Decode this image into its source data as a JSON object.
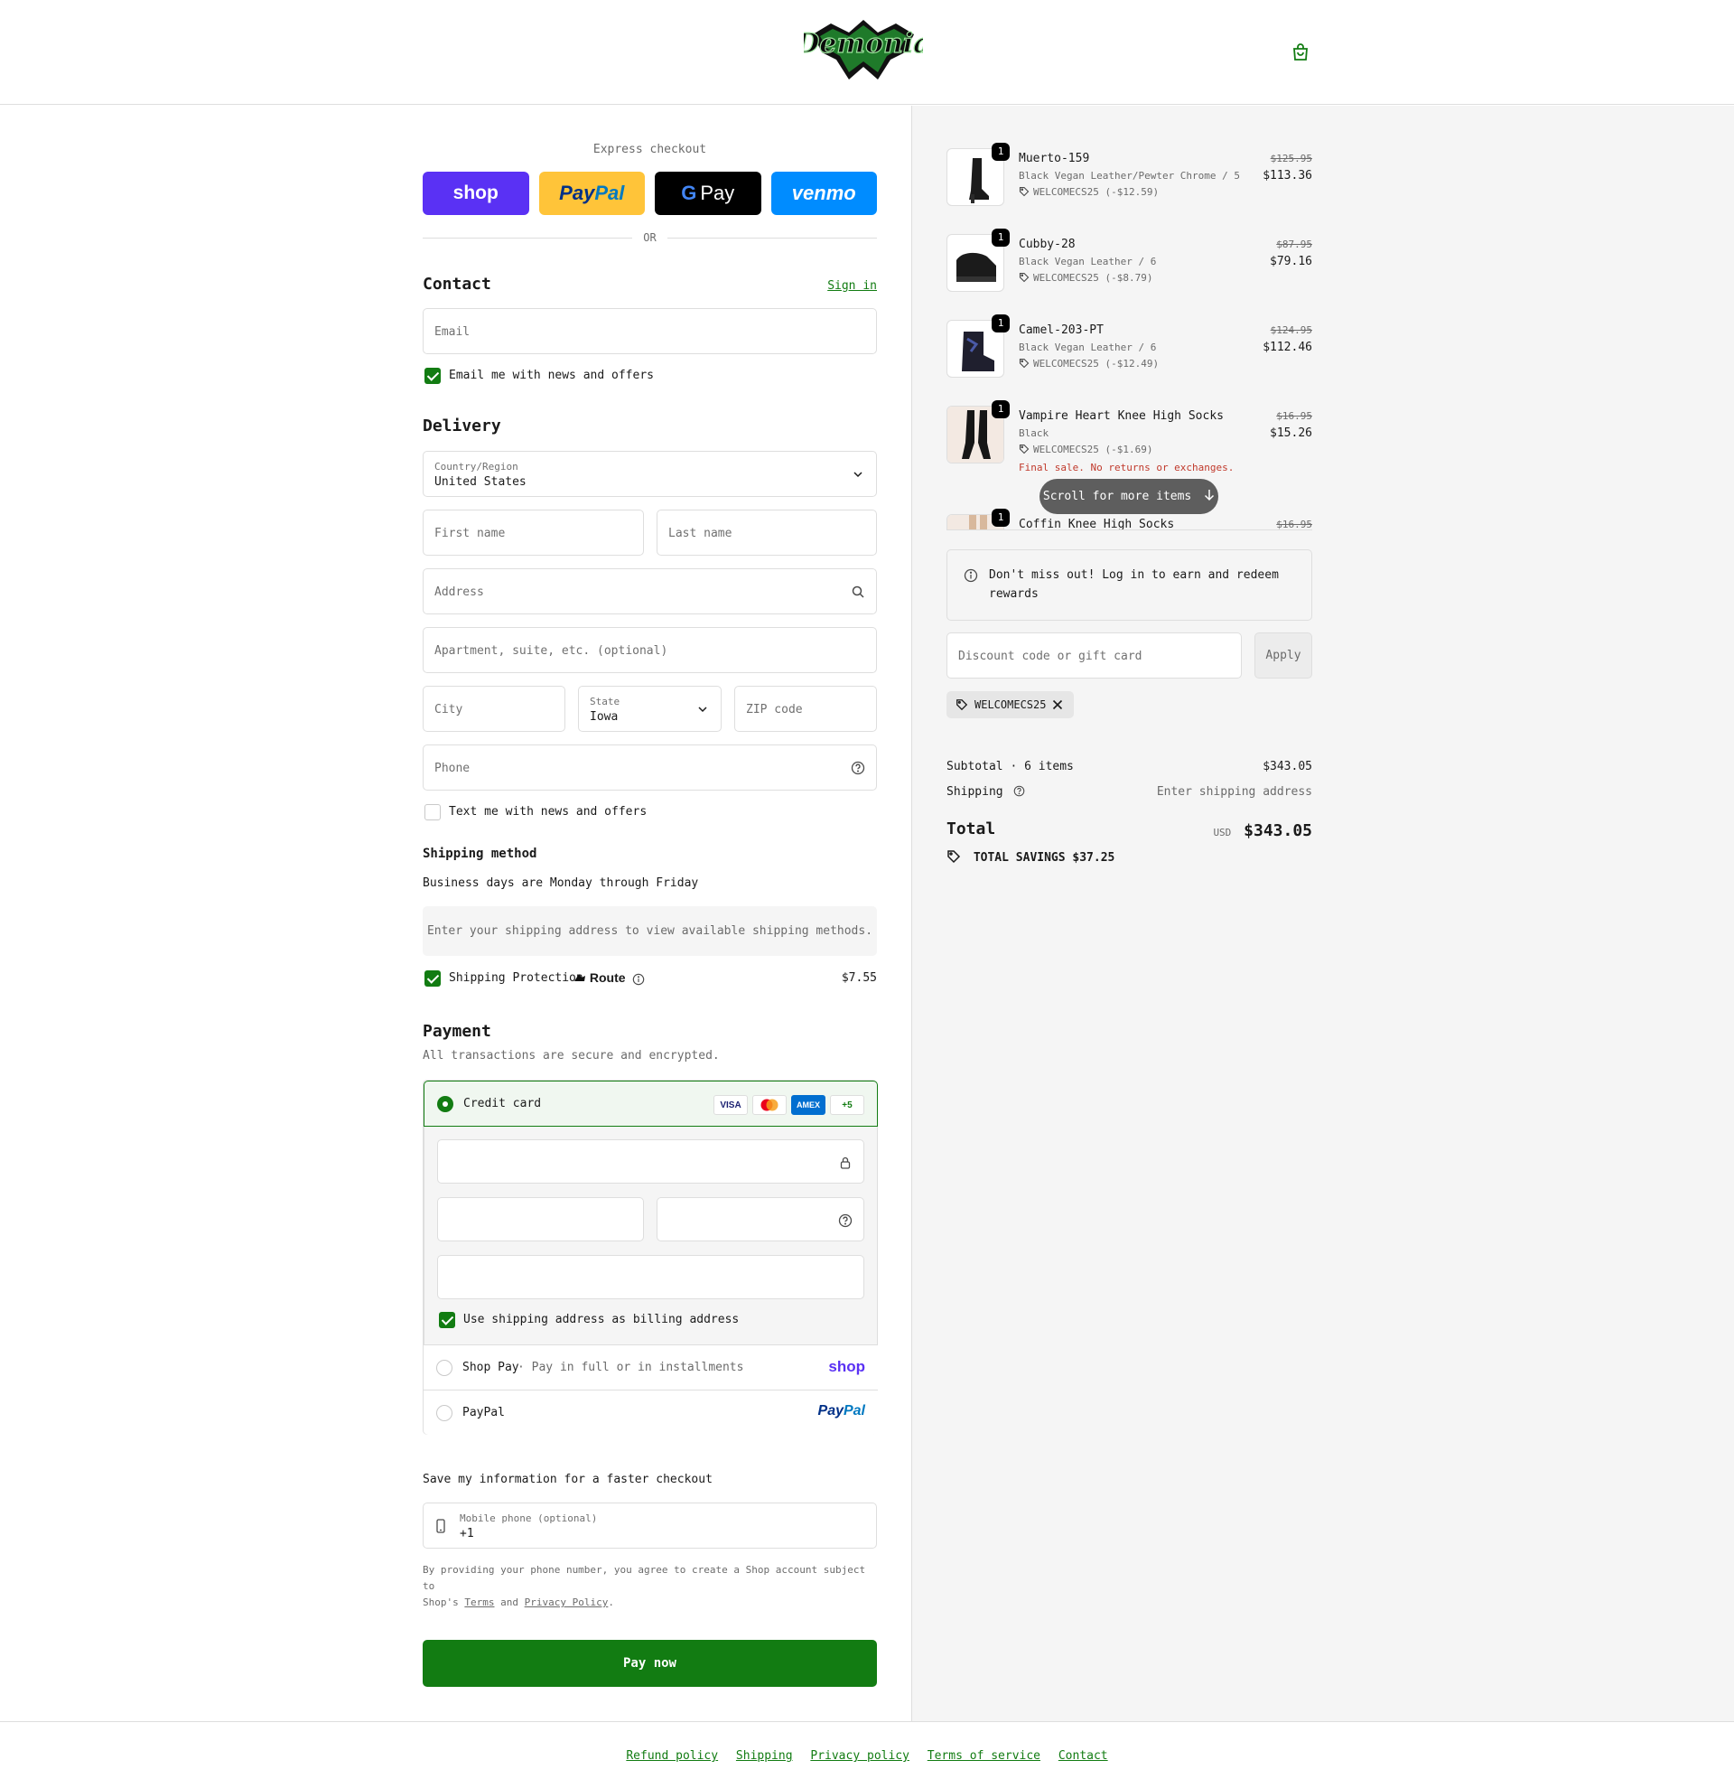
{
  "brand": {
    "accent": "#127c12",
    "logo_name": "Demonia"
  },
  "express": {
    "title": "Express checkout",
    "wallets": [
      {
        "label": "shop",
        "icon": "shop-pay-logo"
      },
      {
        "label_a": "Pay",
        "label_b": "Pal",
        "icon": "paypal-logo"
      },
      {
        "label_a": "G",
        "label_b": "Pay",
        "icon": "google-pay-logo"
      },
      {
        "label": "venmo",
        "icon": "venmo-logo"
      }
    ],
    "or": "OR"
  },
  "contact": {
    "title": "Contact",
    "sign_in": "Sign in",
    "email_placeholder": "Email",
    "news_checkbox_label": "Email me with news and offers",
    "news_checked": true
  },
  "delivery": {
    "title": "Delivery",
    "country_label": "Country/Region",
    "country_value": "United States",
    "first_name_placeholder": "First name",
    "last_name_placeholder": "Last name",
    "address_placeholder": "Address",
    "apartment_placeholder": "Apartment, suite, etc. (optional)",
    "city_placeholder": "City",
    "state_label": "State",
    "state_value": "Iowa",
    "zip_placeholder": "ZIP code",
    "phone_placeholder": "Phone",
    "text_checkbox_label": "Text me with news and offers",
    "text_checked": false
  },
  "shipping_method": {
    "title": "Shipping method",
    "subtitle": "Business days are Monday through Friday",
    "notice": "Enter your shipping address to view available shipping methods.",
    "protection_label": "Shipping Protection",
    "protection_brand": "Route",
    "protection_price": "$7.55",
    "protection_checked": true
  },
  "payment": {
    "title": "Payment",
    "subtitle": "All transactions are secure and encrypted.",
    "credit_card_label": "Credit card",
    "card_logos": [
      "VISA",
      "AMEX",
      "+5"
    ],
    "billing_same_label": "Use shipping address as billing address",
    "billing_same_checked": true,
    "shop_pay_label": "Shop Pay",
    "shop_pay_sub": "· Pay in full or in installments",
    "shop_pay_logo": "shop",
    "paypal_label": "PayPal",
    "paypal_logo_a": "Pay",
    "paypal_logo_b": "Pal"
  },
  "save_info": {
    "title": "Save my information for a faster checkout",
    "phone_label": "Mobile phone (optional)",
    "phone_value": "+1",
    "legal_a": "By providing your phone number, you agree to create a Shop account subject to",
    "legal_b": "Shop's",
    "terms": "Terms",
    "and": "and",
    "privacy": "Privacy Policy",
    "period": "."
  },
  "pay_now": "Pay now",
  "order": {
    "items": [
      {
        "qty": "1",
        "name": "Muerto-159",
        "variant": "Black Vegan Leather/Pewter Chrome / 5",
        "discount": "WELCOMECS25 (-$12.59)",
        "old_price": "$125.95",
        "price": "$113.36"
      },
      {
        "qty": "1",
        "name": "Cubby-28",
        "variant": "Black Vegan Leather / 6",
        "discount": "WELCOMECS25 (-$8.79)",
        "old_price": "$87.95",
        "price": "$79.16"
      },
      {
        "qty": "1",
        "name": "Camel-203-PT",
        "variant": "Black Vegan Leather / 6",
        "discount": "WELCOMECS25 (-$12.49)",
        "old_price": "$124.95",
        "price": "$112.46"
      },
      {
        "qty": "1",
        "name": "Vampire Heart Knee High Socks",
        "variant": "Black",
        "discount": "WELCOMECS25 (-$1.69)",
        "old_price": "$16.95",
        "price": "$15.26",
        "final_sale": "Final sale. No returns or exchanges."
      },
      {
        "qty": "1",
        "name": "Coffin Knee High Socks",
        "old_price": "$16.95"
      }
    ],
    "scroll_hint": "Scroll for more items",
    "rewards_line1": "Don't miss out! Log in to earn and redeem",
    "rewards_line2": "rewards",
    "discount_placeholder": "Discount code or gift card",
    "apply": "Apply",
    "applied_code": "WELCOMECS25",
    "subtotal_label": "Subtotal · 6 items",
    "subtotal_value": "$343.05",
    "shipping_label": "Shipping",
    "shipping_value": "Enter shipping address",
    "total_label": "Total",
    "currency": "USD",
    "total_value": "$343.05",
    "savings": "TOTAL SAVINGS $37.25"
  },
  "footer": {
    "links": [
      "Refund policy",
      "Shipping",
      "Privacy policy",
      "Terms of service",
      "Contact"
    ]
  }
}
